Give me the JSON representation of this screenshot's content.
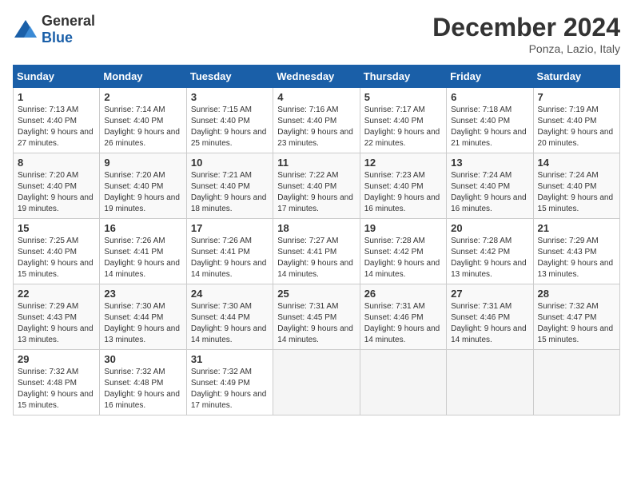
{
  "logo": {
    "general": "General",
    "blue": "Blue"
  },
  "title": "December 2024",
  "location": "Ponza, Lazio, Italy",
  "days_of_week": [
    "Sunday",
    "Monday",
    "Tuesday",
    "Wednesday",
    "Thursday",
    "Friday",
    "Saturday"
  ],
  "weeks": [
    [
      {
        "day": "1",
        "sunrise": "7:13 AM",
        "sunset": "4:40 PM",
        "daylight": "9 hours and 27 minutes."
      },
      {
        "day": "2",
        "sunrise": "7:14 AM",
        "sunset": "4:40 PM",
        "daylight": "9 hours and 26 minutes."
      },
      {
        "day": "3",
        "sunrise": "7:15 AM",
        "sunset": "4:40 PM",
        "daylight": "9 hours and 25 minutes."
      },
      {
        "day": "4",
        "sunrise": "7:16 AM",
        "sunset": "4:40 PM",
        "daylight": "9 hours and 23 minutes."
      },
      {
        "day": "5",
        "sunrise": "7:17 AM",
        "sunset": "4:40 PM",
        "daylight": "9 hours and 22 minutes."
      },
      {
        "day": "6",
        "sunrise": "7:18 AM",
        "sunset": "4:40 PM",
        "daylight": "9 hours and 21 minutes."
      },
      {
        "day": "7",
        "sunrise": "7:19 AM",
        "sunset": "4:40 PM",
        "daylight": "9 hours and 20 minutes."
      }
    ],
    [
      {
        "day": "8",
        "sunrise": "7:20 AM",
        "sunset": "4:40 PM",
        "daylight": "9 hours and 19 minutes."
      },
      {
        "day": "9",
        "sunrise": "7:20 AM",
        "sunset": "4:40 PM",
        "daylight": "9 hours and 19 minutes."
      },
      {
        "day": "10",
        "sunrise": "7:21 AM",
        "sunset": "4:40 PM",
        "daylight": "9 hours and 18 minutes."
      },
      {
        "day": "11",
        "sunrise": "7:22 AM",
        "sunset": "4:40 PM",
        "daylight": "9 hours and 17 minutes."
      },
      {
        "day": "12",
        "sunrise": "7:23 AM",
        "sunset": "4:40 PM",
        "daylight": "9 hours and 16 minutes."
      },
      {
        "day": "13",
        "sunrise": "7:24 AM",
        "sunset": "4:40 PM",
        "daylight": "9 hours and 16 minutes."
      },
      {
        "day": "14",
        "sunrise": "7:24 AM",
        "sunset": "4:40 PM",
        "daylight": "9 hours and 15 minutes."
      }
    ],
    [
      {
        "day": "15",
        "sunrise": "7:25 AM",
        "sunset": "4:40 PM",
        "daylight": "9 hours and 15 minutes."
      },
      {
        "day": "16",
        "sunrise": "7:26 AM",
        "sunset": "4:41 PM",
        "daylight": "9 hours and 14 minutes."
      },
      {
        "day": "17",
        "sunrise": "7:26 AM",
        "sunset": "4:41 PM",
        "daylight": "9 hours and 14 minutes."
      },
      {
        "day": "18",
        "sunrise": "7:27 AM",
        "sunset": "4:41 PM",
        "daylight": "9 hours and 14 minutes."
      },
      {
        "day": "19",
        "sunrise": "7:28 AM",
        "sunset": "4:42 PM",
        "daylight": "9 hours and 14 minutes."
      },
      {
        "day": "20",
        "sunrise": "7:28 AM",
        "sunset": "4:42 PM",
        "daylight": "9 hours and 13 minutes."
      },
      {
        "day": "21",
        "sunrise": "7:29 AM",
        "sunset": "4:43 PM",
        "daylight": "9 hours and 13 minutes."
      }
    ],
    [
      {
        "day": "22",
        "sunrise": "7:29 AM",
        "sunset": "4:43 PM",
        "daylight": "9 hours and 13 minutes."
      },
      {
        "day": "23",
        "sunrise": "7:30 AM",
        "sunset": "4:44 PM",
        "daylight": "9 hours and 13 minutes."
      },
      {
        "day": "24",
        "sunrise": "7:30 AM",
        "sunset": "4:44 PM",
        "daylight": "9 hours and 14 minutes."
      },
      {
        "day": "25",
        "sunrise": "7:31 AM",
        "sunset": "4:45 PM",
        "daylight": "9 hours and 14 minutes."
      },
      {
        "day": "26",
        "sunrise": "7:31 AM",
        "sunset": "4:46 PM",
        "daylight": "9 hours and 14 minutes."
      },
      {
        "day": "27",
        "sunrise": "7:31 AM",
        "sunset": "4:46 PM",
        "daylight": "9 hours and 14 minutes."
      },
      {
        "day": "28",
        "sunrise": "7:32 AM",
        "sunset": "4:47 PM",
        "daylight": "9 hours and 15 minutes."
      }
    ],
    [
      {
        "day": "29",
        "sunrise": "7:32 AM",
        "sunset": "4:48 PM",
        "daylight": "9 hours and 15 minutes."
      },
      {
        "day": "30",
        "sunrise": "7:32 AM",
        "sunset": "4:48 PM",
        "daylight": "9 hours and 16 minutes."
      },
      {
        "day": "31",
        "sunrise": "7:32 AM",
        "sunset": "4:49 PM",
        "daylight": "9 hours and 17 minutes."
      },
      null,
      null,
      null,
      null
    ]
  ]
}
